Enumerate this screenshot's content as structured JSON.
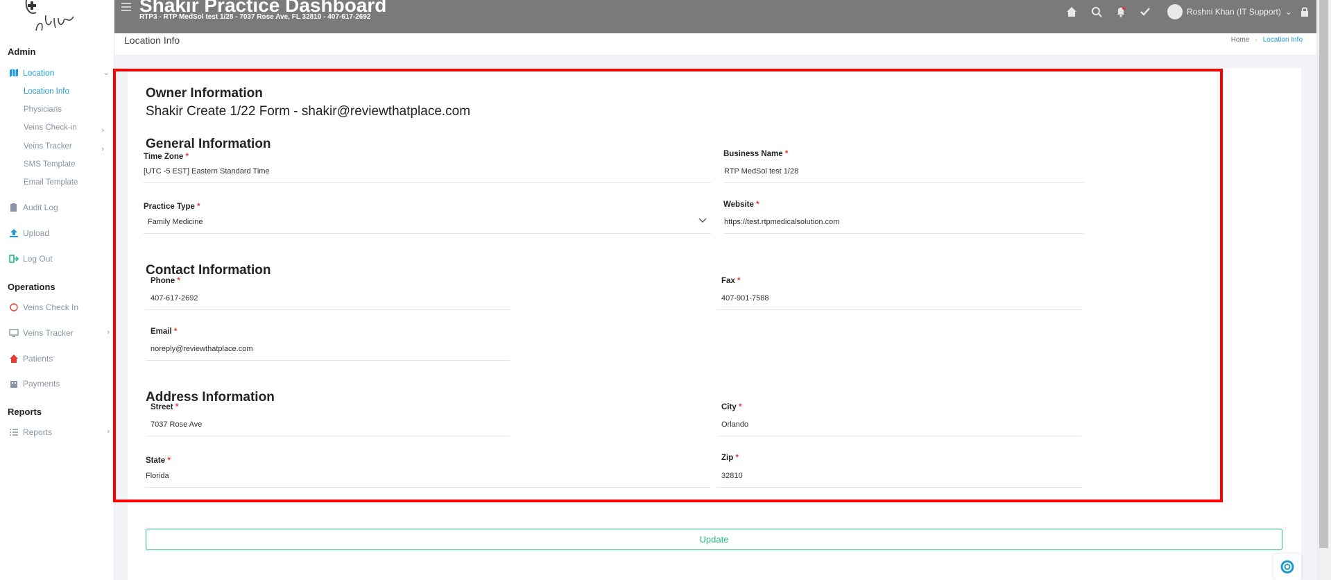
{
  "header": {
    "title": "Shakir Practice Dashboard",
    "subtitle": "RTP3 - RTP MedSol test 1/28 - 7037 Rose Ave, FL 32810 - 407-617-2692",
    "user": "Roshni Khan (IT Support)",
    "icons": [
      "menu-icon",
      "home-icon",
      "search-icon",
      "bell-icon",
      "check-icon",
      "lock-icon"
    ]
  },
  "sidebar": {
    "sections": {
      "admin": "Admin",
      "operations": "Operations",
      "reports": "Reports"
    },
    "location": "Location",
    "location_items": [
      "Location Info",
      "Physicians",
      "Veins Check-in",
      "Veins Tracker",
      "SMS Template",
      "Email Template"
    ],
    "audit_log": "Audit Log",
    "upload": "Upload",
    "logout": "Log Out",
    "veins_check_in": "Veins Check In",
    "veins_tracker": "Veins Tracker",
    "patients": "Patients",
    "payments": "Payments",
    "reports_item": "Reports"
  },
  "page": {
    "title": "Location Info",
    "breadcrumbs": [
      "Home",
      "Location Info"
    ]
  },
  "form": {
    "owner_heading": "Owner Information",
    "owner_line": "Shakir Create 1/22 Form - shakir@reviewthatplace.com",
    "general_heading": "General Information",
    "contact_heading": "Contact Information",
    "address_heading": "Address Information",
    "fields": {
      "time_zone": {
        "label": "Time Zone",
        "value": "[UTC -5 EST] Eastern Standard Time"
      },
      "business_name": {
        "label": "Business Name",
        "value": "RTP MedSol test 1/28"
      },
      "practice_type": {
        "label": "Practice Type",
        "value": "Family Medicine"
      },
      "website": {
        "label": "Website",
        "value": "https://test.rtpmedicalsolution.com"
      },
      "phone": {
        "label": "Phone",
        "value": "407-617-2692"
      },
      "fax": {
        "label": "Fax",
        "value": "407-901-7588"
      },
      "email": {
        "label": "Email",
        "value": "noreply@reviewthatplace.com"
      },
      "street": {
        "label": "Street",
        "value": "7037 Rose Ave"
      },
      "city": {
        "label": "City",
        "value": "Orlando"
      },
      "state": {
        "label": "State",
        "value": "Florida"
      },
      "zip": {
        "label": "Zip",
        "value": "32810"
      }
    },
    "required_mark": "*",
    "update_label": "Update"
  },
  "colors": {
    "accent": "#1e9ad6",
    "header": "#7a7a7a",
    "success": "#27b88a",
    "required": "#e53935",
    "highlight": "#ff0000"
  }
}
